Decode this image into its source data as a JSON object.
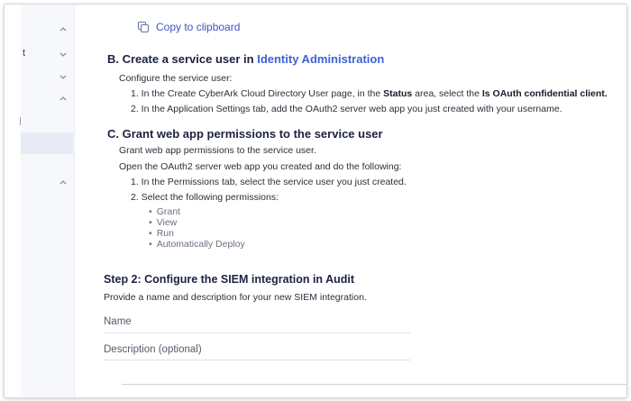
{
  "sidebar": {
    "fragment_text": "t",
    "rows": [
      {
        "chevron": "chevron-up-icon"
      },
      {
        "chevron": "chevron-down-icon"
      },
      {
        "chevron": "chevron-down-icon"
      },
      {
        "chevron": "chevron-up-icon"
      },
      {
        "chevron": "chevron-up-icon"
      }
    ]
  },
  "copy": {
    "label": "Copy to clipboard",
    "icon": "copy-icon"
  },
  "section_b": {
    "title_prefix": "B. Create a service user in ",
    "title_link": "Identity Administration",
    "intro": "Configure the service user:",
    "step1": {
      "pre": "1. In the Create CyberArk Cloud Directory User page, in the ",
      "bold1": "Status",
      "mid": " area, select the ",
      "bold2": "Is OAuth confidential client."
    },
    "step2": "2. In the Application Settings tab, add the OAuth2 server web app you just created with your username."
  },
  "section_c": {
    "title": "C. Grant web app permissions to the service user",
    "intro1": "Grant web app permissions to the service user.",
    "intro2": "Open the OAuth2 server web app you created and do the following:",
    "step1": "1. In the Permissions tab, select the service user you just created.",
    "step2": "2. Select the following permissions:",
    "permissions": [
      "Grant",
      "View",
      "Run",
      "Automatically Deploy"
    ]
  },
  "step2": {
    "title": "Step 2: Configure the SIEM integration in Audit",
    "description": "Provide a name and description for your new SIEM integration.",
    "name_label": "Name",
    "description_label": "Description (optional)"
  },
  "colors": {
    "link": "#3e62d8",
    "heading": "#1c2140",
    "sidebar_active": "#e8ebf6"
  }
}
